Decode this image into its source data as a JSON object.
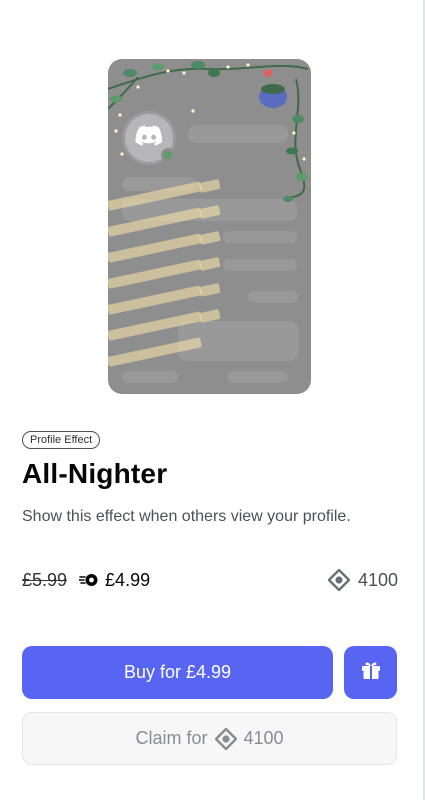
{
  "product": {
    "badge": "Profile Effect",
    "title": "All-Nighter",
    "description": "Show this effect when others view your profile."
  },
  "pricing": {
    "original_price": "£5.99",
    "nitro_price": "£4.99",
    "orbs_price": "4100"
  },
  "actions": {
    "buy_label": "Buy for £4.99",
    "claim_prefix": "Claim for",
    "claim_amount": "4100"
  },
  "colors": {
    "brand": "#5865f2",
    "preview_bg": "#8e8e8f",
    "online": "#5b9c6a"
  },
  "icons": {
    "nitro": "nitro-icon",
    "orb": "orb-icon",
    "gift": "gift-icon",
    "discord": "discord-logo-icon"
  }
}
